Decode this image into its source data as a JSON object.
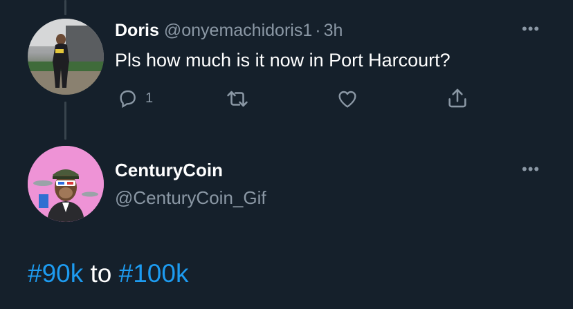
{
  "reply_tweet": {
    "author_name": "Doris",
    "author_handle": "@onyemachidoris1",
    "separator": "·",
    "time": "3h",
    "text": "Pls how much is it now in Port Harcourt?",
    "reply_count": "1"
  },
  "main_tweet": {
    "author_name": "CenturyCoin",
    "author_handle": "@CenturyCoin_Gif",
    "hashtag_1": "#90k",
    "connector": " to ",
    "hashtag_2": "#100k"
  },
  "icons": [
    "more-icon",
    "reply-icon",
    "retweet-icon",
    "like-icon",
    "share-icon"
  ],
  "colors": {
    "background": "#15202b",
    "muted": "#8b98a5",
    "accent": "#1d9bf0",
    "thread_line": "#38444d"
  }
}
